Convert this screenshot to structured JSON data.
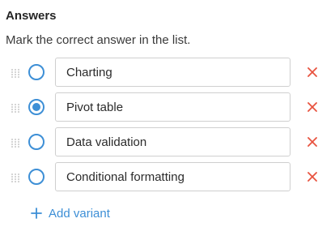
{
  "section": {
    "title": "Answers",
    "instructions": "Mark the correct answer in the list."
  },
  "answers": [
    {
      "label": "Charting",
      "correct": false
    },
    {
      "label": "Pivot table",
      "correct": true
    },
    {
      "label": "Data validation",
      "correct": false
    },
    {
      "label": "Conditional formatting",
      "correct": false
    }
  ],
  "add_variant": {
    "label": "Add variant",
    "icon": "plus-icon"
  },
  "icons": {
    "drag": "drag-handle-icon",
    "remove": "close-icon"
  },
  "colors": {
    "accent": "#3d8fd6",
    "remove": "#e8533f",
    "border": "#cfcfcf"
  }
}
